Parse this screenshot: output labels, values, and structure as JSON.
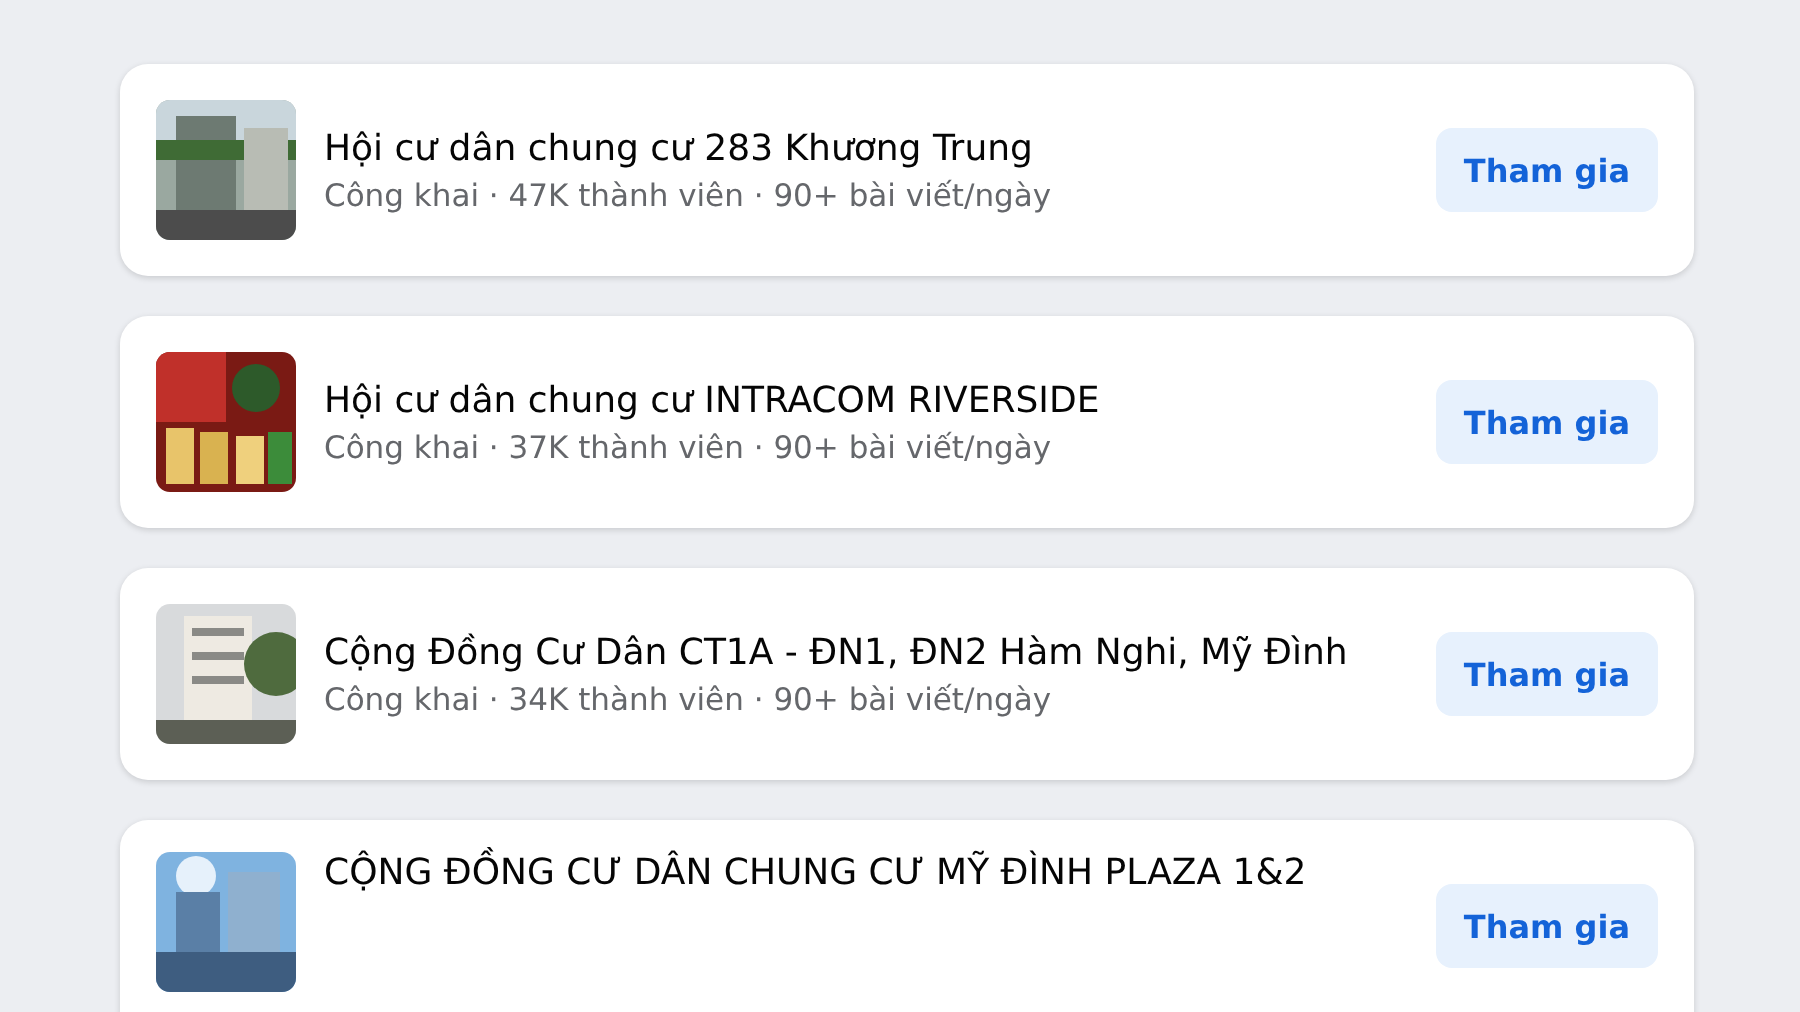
{
  "groups": [
    {
      "name": "Hội cư dân chung cư 283 Khương Trung",
      "meta": "Công khai · 47K thành viên · 90+ bài viết/ngày",
      "button": "Tham gia"
    },
    {
      "name": "Hội cư dân chung cư INTRACOM RIVERSIDE",
      "meta": "Công khai · 37K thành viên · 90+ bài viết/ngày",
      "button": "Tham gia"
    },
    {
      "name": "Cộng Đồng Cư Dân CT1A - ĐN1, ĐN2 Hàm Nghi, Mỹ Đình",
      "meta": "Công khai · 34K thành viên · 90+ bài viết/ngày",
      "button": "Tham gia"
    },
    {
      "name": "CỘNG ĐỒNG CƯ DÂN CHUNG CƯ MỸ ĐÌNH PLAZA 1&2",
      "button": "Tham gia"
    }
  ]
}
